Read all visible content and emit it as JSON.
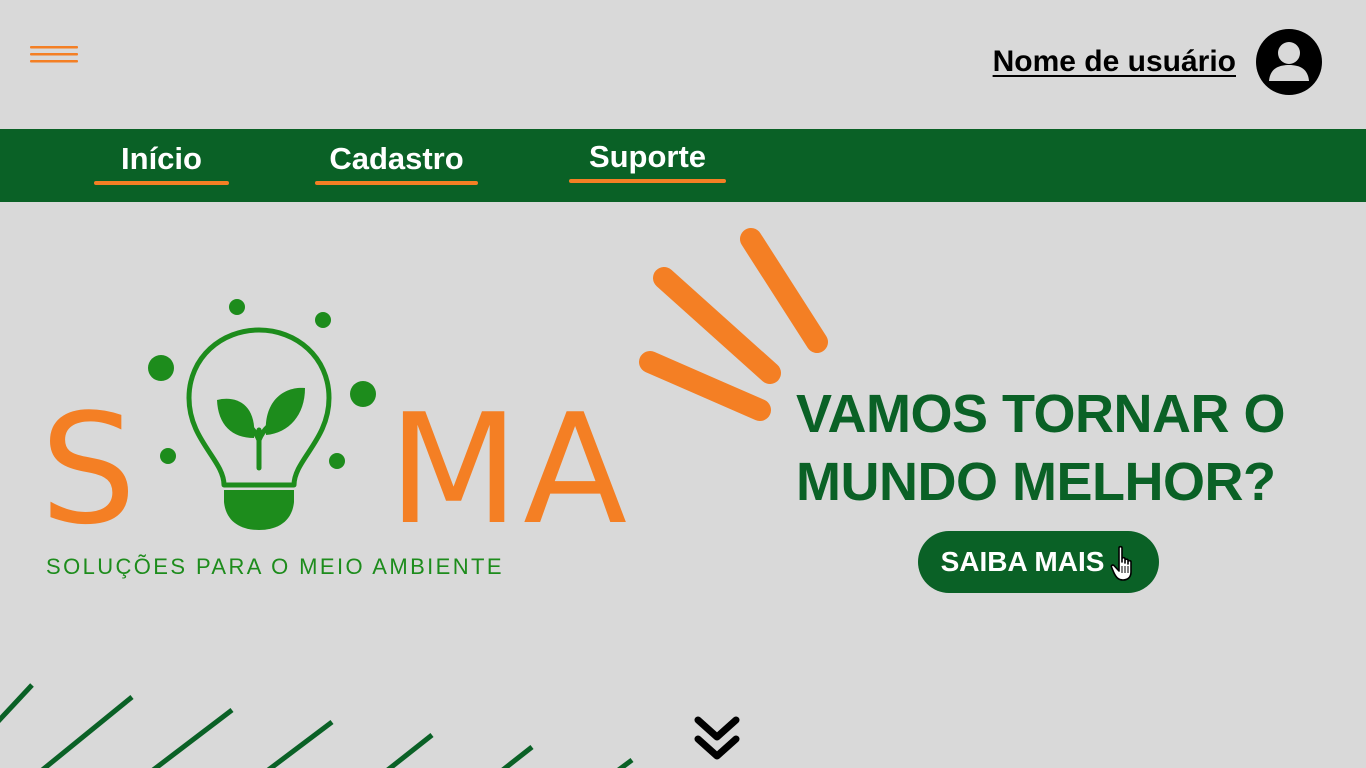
{
  "colors": {
    "background": "#d9d9d9",
    "green": "#0a6126",
    "logo_green": "#1d8c1c",
    "orange": "#f47f24",
    "black": "#000000",
    "white": "#ffffff"
  },
  "header": {
    "menu_icon": "hamburger-menu-icon",
    "user_name": "Nome de usuário",
    "avatar_icon": "user-avatar-icon"
  },
  "nav": {
    "items": [
      {
        "label": "Início"
      },
      {
        "label": "Cadastro"
      },
      {
        "label": "Suporte"
      }
    ]
  },
  "logo": {
    "letter_s": "S",
    "letters_ma": "MA",
    "tagline": "SOLUÇÕES PARA O MEIO AMBIENTE",
    "bulb_icon": "lightbulb-sprout-icon"
  },
  "hero": {
    "headline_line1": "VAMOS TORNAR O",
    "headline_line2": "MUNDO MELHOR?",
    "cta_label": "SAIBA MAIS",
    "cta_icon": "pointer-hand-icon",
    "rays_icon": "emphasis-rays-icon",
    "scroll_icon": "double-chevron-down-icon"
  }
}
